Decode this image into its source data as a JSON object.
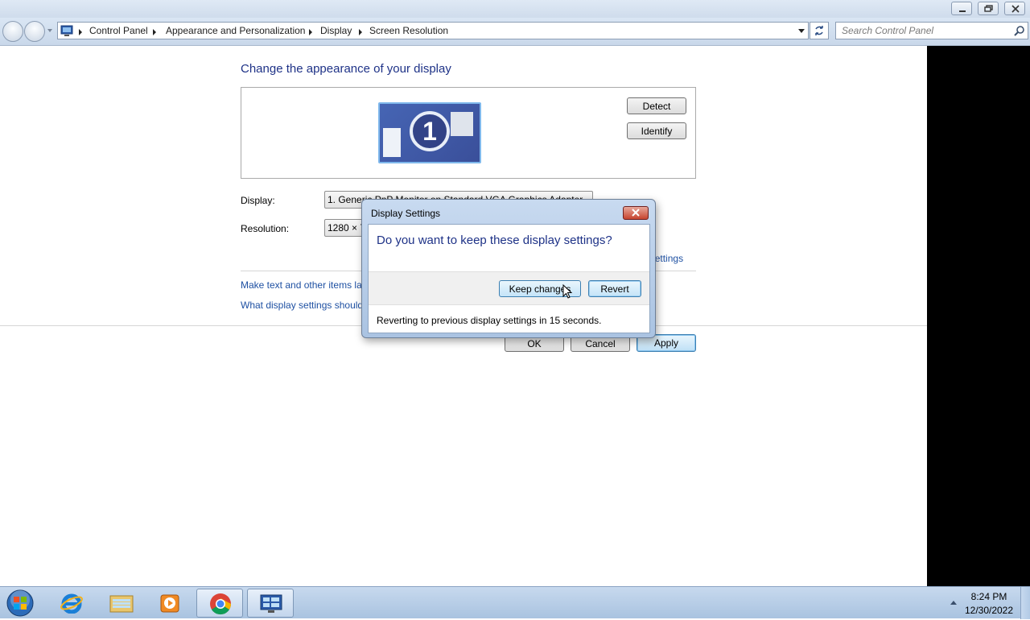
{
  "window": {
    "controls": {
      "minimize": "minimize",
      "restore": "restore",
      "close": "close"
    }
  },
  "breadcrumb": {
    "items": [
      "Control Panel",
      "Appearance and Personalization",
      "Display",
      "Screen Resolution"
    ]
  },
  "search": {
    "placeholder": "Search Control Panel"
  },
  "main": {
    "heading": "Change the appearance of your display",
    "detect_label": "Detect",
    "identify_label": "Identify",
    "monitor_number": "1",
    "display_label": "Display:",
    "display_value": "1. Generic PnP Monitor on Standard VGA Graphics Adapter",
    "resolution_label": "Resolution:",
    "resolution_value": "1280 × 768",
    "advanced_settings_link": "Advanced settings",
    "make_text_link": "Make text and other items larger or smaller",
    "what_settings_link": "What display settings should I choose?",
    "ok_label": "OK",
    "cancel_label": "Cancel",
    "apply_label": "Apply"
  },
  "dialog": {
    "title": "Display Settings",
    "question": "Do you want to keep these display settings?",
    "keep_label": "Keep changes",
    "revert_label": "Revert",
    "status": "Reverting to previous display settings in 15 seconds."
  },
  "taskbar": {
    "items": [
      "start-orb",
      "internet-explorer",
      "windows-explorer",
      "media-player",
      "chrome",
      "control-panel"
    ],
    "time": "8:24 PM",
    "date": "12/30/2022"
  },
  "colors": {
    "heading": "#1e3287",
    "link": "#1e50a2",
    "taskbar": "#b8cfe8"
  }
}
